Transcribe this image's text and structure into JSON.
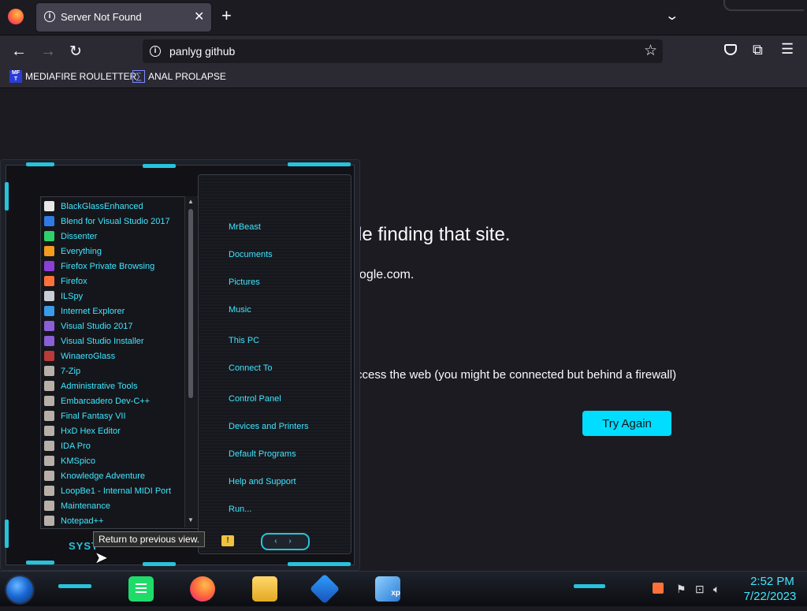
{
  "browser": {
    "tab": {
      "title": "Server Not Found",
      "close": "✕"
    },
    "new_tab": "+",
    "tab_list": "⌄",
    "nav": {
      "back": "←",
      "forward": "→",
      "reload": "↻"
    },
    "url": "panlyg github",
    "bookmarks": [
      {
        "label": "MEDIAFIRE ROULETTER",
        "icon_text": "MF T"
      },
      {
        "label": "ANAL PROLAPSE",
        "icon_text": "∑"
      }
    ]
  },
  "error_page": {
    "title_visible": "le finding that site.",
    "line1_visible": "w.google.com.",
    "line3_visible": "ccess the web (you might be connected but behind a firewall)",
    "try_again": "Try Again"
  },
  "start_menu": {
    "programs": [
      {
        "label": "BlackGlassEnhanced",
        "icon_color": "#e8e8e8"
      },
      {
        "label": "Blend for Visual Studio 2017",
        "icon_color": "#2f7be5"
      },
      {
        "label": "Dissenter",
        "icon_color": "#2fd06a"
      },
      {
        "label": "Everything",
        "icon_color": "#f39c1e"
      },
      {
        "label": "Firefox Private Browsing",
        "icon_color": "#8b3fd6"
      },
      {
        "label": "Firefox",
        "icon_color": "#ff7139"
      },
      {
        "label": "ILSpy",
        "icon_color": "#c9ced6"
      },
      {
        "label": "Internet Explorer",
        "icon_color": "#3a9be8"
      },
      {
        "label": "Visual Studio 2017",
        "icon_color": "#8b5fd6"
      },
      {
        "label": "Visual Studio Installer",
        "icon_color": "#8b5fd6"
      },
      {
        "label": "WinaeroGlass",
        "icon_color": "#b83a3a"
      },
      {
        "label": "7-Zip",
        "icon_color": "#b8b0a8"
      },
      {
        "label": "Administrative Tools",
        "icon_color": "#b8b0a8"
      },
      {
        "label": "Embarcadero Dev-C++",
        "icon_color": "#b8b0a8"
      },
      {
        "label": "Final Fantasy VII",
        "icon_color": "#b8b0a8"
      },
      {
        "label": "HxD Hex Editor",
        "icon_color": "#b8b0a8"
      },
      {
        "label": "IDA Pro",
        "icon_color": "#b8b0a8"
      },
      {
        "label": "KMSpico",
        "icon_color": "#b8b0a8"
      },
      {
        "label": "Knowledge Adventure",
        "icon_color": "#b8b0a8"
      },
      {
        "label": "LoopBe1 - Internal MIDI Port",
        "icon_color": "#b8b0a8"
      },
      {
        "label": "Maintenance",
        "icon_color": "#b8b0a8"
      },
      {
        "label": "Notepad++",
        "icon_color": "#b8b0a8"
      }
    ],
    "places": [
      "MrBeast",
      "Documents",
      "Pictures",
      "Music",
      "This PC",
      "Connect To",
      "Control Panel",
      "Devices and Printers",
      "Default Programs",
      "Help and Support",
      "Run..."
    ],
    "system_label": "SYST",
    "tooltip": "Return to previous view.",
    "arrows": "‹ ›"
  },
  "taskbar": {
    "icons": [
      "notes-icon",
      "firefox-icon",
      "file-explorer-icon",
      "virtualbox-icon",
      "xp-icon"
    ],
    "xp_text": "xp",
    "clock_time": "2:52 PM",
    "clock_date": "7/22/2023"
  },
  "colors": {
    "accent": "#00ddff",
    "menu_text": "#3fe6ff",
    "page_bg": "#1c1b22"
  }
}
